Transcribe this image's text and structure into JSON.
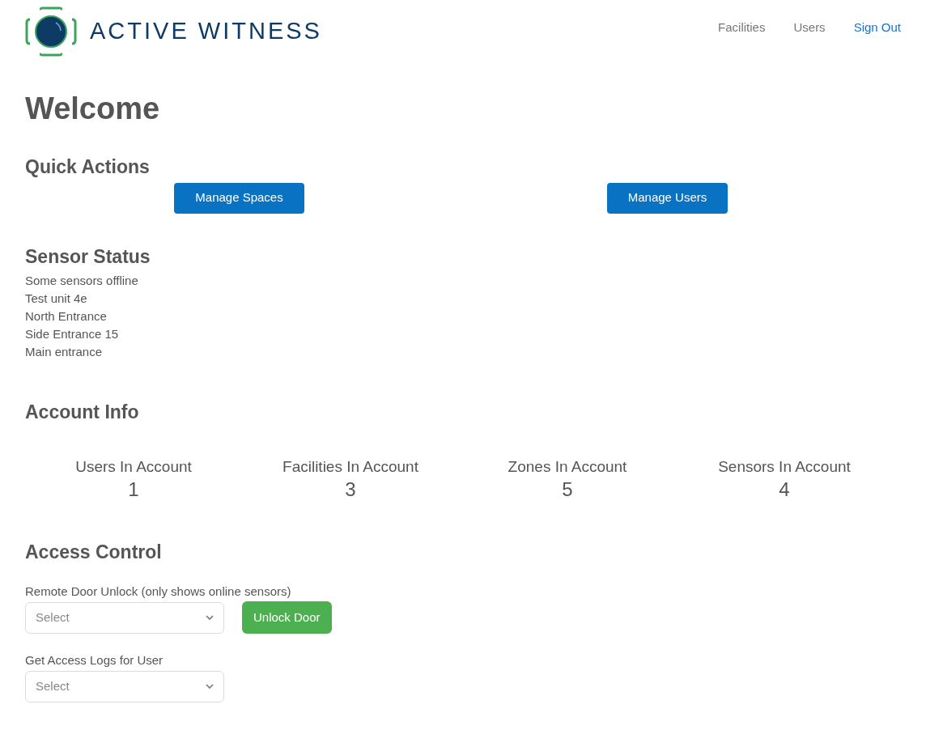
{
  "logo": {
    "text": "ACTIVE WITNESS"
  },
  "nav": [
    {
      "label": "Facilities",
      "kind": "page"
    },
    {
      "label": "Users",
      "kind": "page"
    },
    {
      "label": "Sign Out",
      "kind": "action"
    }
  ],
  "title": "Welcome",
  "quick_actions": {
    "heading": "Quick Actions",
    "buttons": [
      "Manage Spaces",
      "Manage Users"
    ]
  },
  "sensor_status": {
    "heading": "Sensor Status",
    "lines": [
      "Some sensors offline",
      "Test unit 4e",
      "North Entrance",
      "Side Entrance 15",
      "Main entrance"
    ]
  },
  "account_info": {
    "heading": "Account Info",
    "stats": [
      {
        "label": "Users In Account",
        "value": "1"
      },
      {
        "label": "Facilities In Account",
        "value": "3"
      },
      {
        "label": "Zones In Account",
        "value": "5"
      },
      {
        "label": "Sensors In Account",
        "value": "4"
      }
    ]
  },
  "access_control": {
    "heading": "Access Control",
    "unlock": {
      "label": "Remote Door Unlock (only shows online sensors)",
      "placeholder": "Select",
      "button": "Unlock Door"
    },
    "logs": {
      "label": "Get Access Logs for User",
      "placeholder": "Select"
    }
  }
}
